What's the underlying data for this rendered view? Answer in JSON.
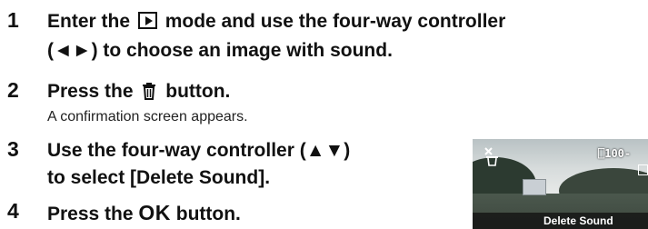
{
  "steps": [
    {
      "number": "1",
      "line1_before": "Enter the",
      "line1_after": "mode and use the four-way controller",
      "line2": "(◄►) to choose an image with sound."
    },
    {
      "number": "2",
      "text_before": "Press the",
      "text_after": "button.",
      "note": "A confirmation screen appears."
    },
    {
      "number": "3",
      "line1": "Use the four-way controller (▲▼)",
      "line2": "to select [Delete Sound]."
    },
    {
      "number": "4",
      "text_before": "Press the",
      "ok_label": "OK",
      "text_after": "button."
    }
  ],
  "icons": {
    "playback": "playback-mode-icon",
    "trash": "trash-can-icon",
    "protect_delete": "delete-image-icon"
  },
  "preview": {
    "file_number": "100-",
    "menu_text": "Delete Sound"
  }
}
